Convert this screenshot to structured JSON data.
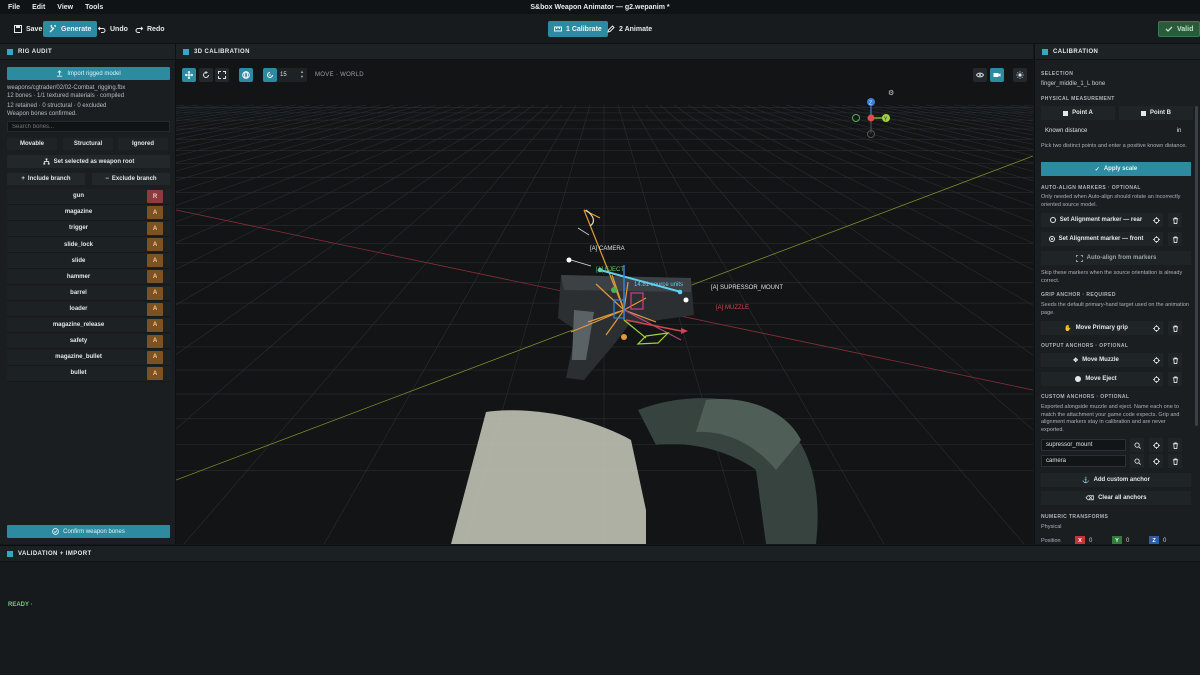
{
  "menubar": {
    "items": [
      "File",
      "Edit",
      "View",
      "Tools"
    ],
    "title": "S&box Weapon Animator — g2.wepanim *"
  },
  "toolbar": {
    "save": "Save",
    "generate": "Generate",
    "undo": "Undo",
    "redo": "Redo",
    "step1": "1 Calibrate",
    "step2": "2 Animate",
    "valid": "Valid"
  },
  "left": {
    "header": "RIG AUDIT",
    "import_label": "Import rigged model",
    "file_path": "weapons/cgtrader/02/02-Combat_rigging.fbx",
    "file_stats": "12 bones · 1/1 textured materials · compiled",
    "retained": "12 retained · 0 structural · 0 excluded",
    "confirmed": "Weapon bones confirmed.",
    "search_placeholder": "Search bones...",
    "seg_movable": "Movable",
    "seg_structural": "Structural",
    "seg_ignored": "Ignored",
    "set_root": "Set selected as weapon root",
    "include_branch": "Include branch",
    "exclude_branch": "Exclude branch",
    "bones": [
      {
        "name": "gun",
        "tag": "R"
      },
      {
        "name": "magazine",
        "tag": "A"
      },
      {
        "name": "trigger",
        "tag": "A"
      },
      {
        "name": "slide_lock",
        "tag": "A"
      },
      {
        "name": "slide",
        "tag": "A"
      },
      {
        "name": "hammer",
        "tag": "A"
      },
      {
        "name": "barrel",
        "tag": "A"
      },
      {
        "name": "loader",
        "tag": "A"
      },
      {
        "name": "magazine_release",
        "tag": "A"
      },
      {
        "name": "safety",
        "tag": "A"
      },
      {
        "name": "magazine_bullet",
        "tag": "A"
      },
      {
        "name": "bullet",
        "tag": "A"
      }
    ],
    "confirm_label": "Confirm weapon bones"
  },
  "center": {
    "header": "3D CALIBRATION",
    "snap_value": "15",
    "mode": "MOVE · WORLD",
    "labels": {
      "camera": "[A] CAMERA",
      "eject": "[A] EJECT",
      "units": "14.81 source units",
      "suppressor": "[A] SUPRESSOR_MOUNT",
      "muzzle": "[A] MUZZLE"
    },
    "colors": {
      "accent": "#2c8aa1",
      "x_axis": "#e04a4a",
      "y_axis": "#9fd23c",
      "z_axis": "#3a7fd6"
    }
  },
  "right": {
    "header": "CALIBRATION",
    "selection_title": "SELECTION",
    "selection_value": "finger_middle_1_L bone",
    "physical_title": "PHYSICAL MEASUREMENT",
    "point_a": "Point A",
    "point_b": "Point B",
    "known_distance": "Known distance",
    "unit": "in",
    "pick_note": "Pick two distinct points and enter a positive known distance.",
    "apply_scale": "Apply scale",
    "auto_align_title": "AUTO-ALIGN MARKERS · OPTIONAL",
    "auto_align_note": "Only needed when Auto-align should rotate an incorrectly oriented source model.",
    "marker_rear": "Set Alignment marker — rear",
    "marker_front": "Set Alignment marker — front",
    "auto_align_btn": "Auto-align from markers",
    "skip_note": "Skip these markers when the source orientation is already correct.",
    "grip_title": "GRIP ANCHOR · REQUIRED",
    "grip_note": "Seeds the default primary-hand target used on the animation page.",
    "move_grip": "Move Primary grip",
    "output_title": "OUTPUT ANCHORS · OPTIONAL",
    "move_muzzle": "Move Muzzle",
    "move_eject": "Move Eject",
    "custom_title": "CUSTOM ANCHORS · OPTIONAL",
    "custom_note": "Exported alongside muzzle and eject. Name each one to match the attachment your game code expects. Grip and alignment markers stay in calibration and are never exported.",
    "custom_1": "supressor_mount",
    "custom_2": "camera",
    "add_custom": "Add custom anchor",
    "clear_all": "Clear all anchors",
    "numeric_title": "NUMERIC TRANSFORMS",
    "physical_label": "Physical",
    "position_label": "Position",
    "x_label": "X",
    "y_label": "Y",
    "z_label": "Z",
    "x_val": "0",
    "y_val": "0",
    "z_val": "0"
  },
  "bottom": {
    "header": "VALIDATION + IMPORT",
    "status": "READY ·"
  }
}
